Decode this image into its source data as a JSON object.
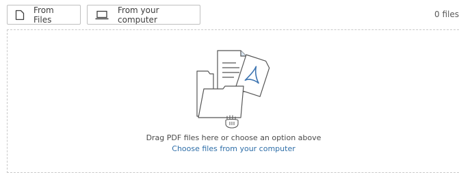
{
  "toolbar": {
    "from_files_label": "From Files",
    "from_computer_label": "From your computer",
    "file_icon": "file-icon",
    "laptop_icon": "laptop-icon"
  },
  "file_count": "0 files",
  "dropzone": {
    "illustration_icon": "folder-documents-pdf-illustration",
    "drag_text": "Drag PDF files here or choose an option above",
    "choose_link": "Choose files from your computer"
  },
  "colors": {
    "link": "#2e6ea8",
    "border": "#bfbfbf",
    "dashed_border": "#c8c8c8",
    "text": "#3c3c3c"
  }
}
